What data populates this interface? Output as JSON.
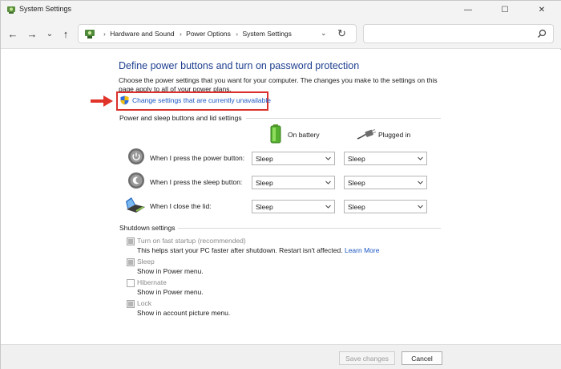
{
  "window": {
    "title": "System Settings",
    "controls": {
      "minimize": "—",
      "maximize": "☐",
      "close": "✕"
    }
  },
  "nav": {
    "back": "←",
    "forward": "→",
    "recent": "⌄",
    "up": "↑",
    "breadcrumb": [
      "Hardware and Sound",
      "Power Options",
      "System Settings"
    ],
    "separator": "›",
    "dropdown": "⌄",
    "refresh": "↻",
    "search_placeholder": ""
  },
  "page": {
    "heading": "Define power buttons and turn on password protection",
    "description": "Choose the power settings that you want for your computer. The changes you make to the settings on this page apply to all of your power plans.",
    "change_link": "Change settings that are currently unavailable"
  },
  "power_section": {
    "title": "Power and sleep buttons and lid settings",
    "col_battery": "On battery",
    "col_plugged": "Plugged in",
    "rows": [
      {
        "label": "When I press the power button:",
        "battery": "Sleep",
        "plugged": "Sleep",
        "icon": "power-button-icon"
      },
      {
        "label": "When I press the sleep button:",
        "battery": "Sleep",
        "plugged": "Sleep",
        "icon": "sleep-button-icon"
      },
      {
        "label": "When I close the lid:",
        "battery": "Sleep",
        "plugged": "Sleep",
        "icon": "laptop-lid-icon"
      }
    ]
  },
  "shutdown_section": {
    "title": "Shutdown settings",
    "items": [
      {
        "label": "Turn on fast startup (recommended)",
        "desc": "This helps start your PC faster after shutdown. Restart isn't affected.",
        "link": "Learn More",
        "checked": true
      },
      {
        "label": "Sleep",
        "desc": "Show in Power menu.",
        "checked": true
      },
      {
        "label": "Hibernate",
        "desc": "Show in Power menu.",
        "checked": false
      },
      {
        "label": "Lock",
        "desc": "Show in account picture menu.",
        "checked": true
      }
    ]
  },
  "footer": {
    "save": "Save changes",
    "cancel": "Cancel"
  },
  "colors": {
    "heading": "#1e3f8f",
    "link": "#1a56c2",
    "highlight": "#d9312b"
  }
}
